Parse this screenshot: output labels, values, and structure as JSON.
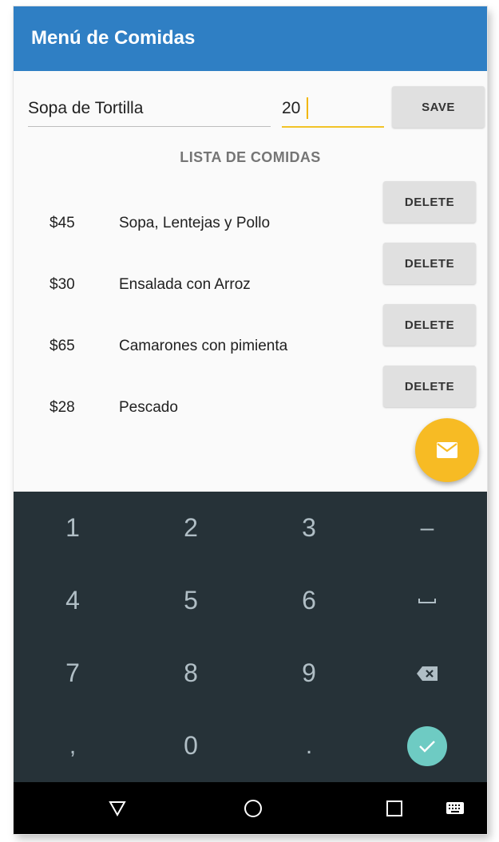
{
  "app": {
    "title": "Menú de Comidas",
    "accent_color": "#2f7fc4",
    "fab_color": "#f7bb24"
  },
  "form": {
    "food_name_value": "Sopa de Tortilla",
    "price_value": "20",
    "save_label": "SAVE"
  },
  "list": {
    "heading": "LISTA DE COMIDAS",
    "delete_label": "DELETE",
    "items": [
      {
        "price": "$45",
        "name": "Sopa, Lentejas y Pollo"
      },
      {
        "price": "$30",
        "name": "Ensalada con Arroz"
      },
      {
        "price": "$65",
        "name": "Camarones con pimienta"
      },
      {
        "price": "$28",
        "name": "Pescado"
      }
    ]
  },
  "fab": {
    "icon": "mail-icon"
  },
  "keyboard": {
    "keys": [
      "1",
      "2",
      "3",
      "–",
      "4",
      "5",
      "6",
      "space",
      "7",
      "8",
      "9",
      "backspace",
      ",",
      "0",
      ".",
      "done"
    ],
    "key_1": "1",
    "key_2": "2",
    "key_3": "3",
    "key_dash": "–",
    "key_4": "4",
    "key_5": "5",
    "key_6": "6",
    "key_7": "7",
    "key_8": "8",
    "key_9": "9",
    "key_comma": ",",
    "key_0": "0",
    "key_period": ".",
    "background": "#263238",
    "done_color": "#6ecbc3"
  },
  "navbar": {
    "icons": [
      "back-icon",
      "home-icon",
      "recents-icon",
      "keyboard-icon"
    ]
  }
}
